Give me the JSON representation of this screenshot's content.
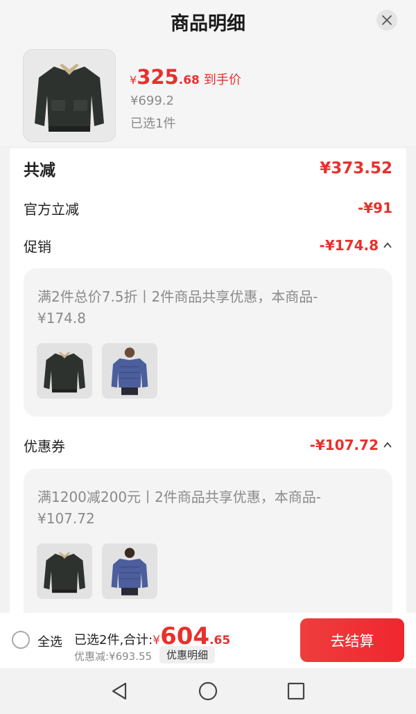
{
  "header": {
    "title": "商品明细",
    "close_icon": "close-icon"
  },
  "product": {
    "currency": "¥",
    "price_int": "325",
    "price_dec": ".68",
    "price_tag": "到手价",
    "original_price": "¥699.2",
    "selected": "已选1件",
    "image_icon": "leather-jacket-image"
  },
  "breakdown": {
    "total_label": "共减",
    "total_value": "¥373.52",
    "official_label": "官方立减",
    "official_value": "-¥91",
    "promo_label": "促销",
    "promo_value": "-¥174.8",
    "promo_text": "满2件总价7.5折丨2件商品共享优惠，本商品-¥174.8",
    "coupon_label": "优惠券",
    "coupon_value": "-¥107.72",
    "coupon_text": "满1200减200元丨2件商品共享优惠，本商品-¥107.72"
  },
  "bottom": {
    "select_all": "全选",
    "selected_total_label": "已选2件,合计:",
    "currency": "¥",
    "total_int": "604",
    "total_dec": ".65",
    "discount_text": "优惠减:¥693.55",
    "detail_button": "优惠明细",
    "checkout_button": "去结算"
  },
  "colors": {
    "accent": "#e8302c",
    "muted": "#8a8a8a",
    "checkout": "#f0262f"
  },
  "nav": {
    "back_icon": "back-triangle-icon",
    "home_icon": "home-circle-icon",
    "recents_icon": "recents-square-icon"
  }
}
